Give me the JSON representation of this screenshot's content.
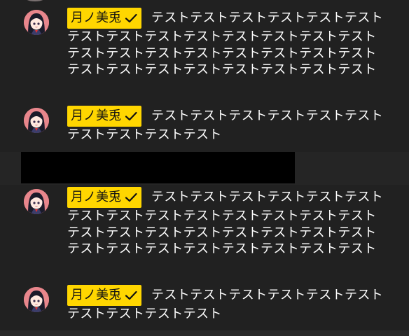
{
  "theme": {
    "background": "#252525",
    "message_block_background": "#212121",
    "author_chip_color": "#ffd600",
    "author_text_color": "#111111",
    "message_text_color": "#ffffff",
    "redaction_color": "#000000"
  },
  "messages": [
    {
      "author": "月ノ美兎",
      "author_badge": "checkmark-icon",
      "avatar": "avatar-girl-icon",
      "text": "テストテストテストテストテストテストテストテストテストテストテストテストテストテストテストテストテストテストテストテストテストテストテストテストテストテストテストテストテストテスト"
    },
    {
      "author": "月ノ美兎",
      "author_badge": "checkmark-icon",
      "avatar": "avatar-girl-icon",
      "text": "テストテストテストテストテストテストテストテストテストテスト"
    },
    {
      "author": "月ノ美兎",
      "author_badge": "checkmark-icon",
      "avatar": "avatar-girl-icon",
      "text": "テストテストテストテストテストテストテストテストテストテストテストテストテストテストテストテストテストテストテストテストテストテストテストテストテストテストテストテストテストテスト"
    },
    {
      "author": "月ノ美兎",
      "author_badge": "checkmark-icon",
      "avatar": "avatar-girl-icon",
      "text": "テストテストテストテストテストテストテストテストテストテスト"
    }
  ]
}
